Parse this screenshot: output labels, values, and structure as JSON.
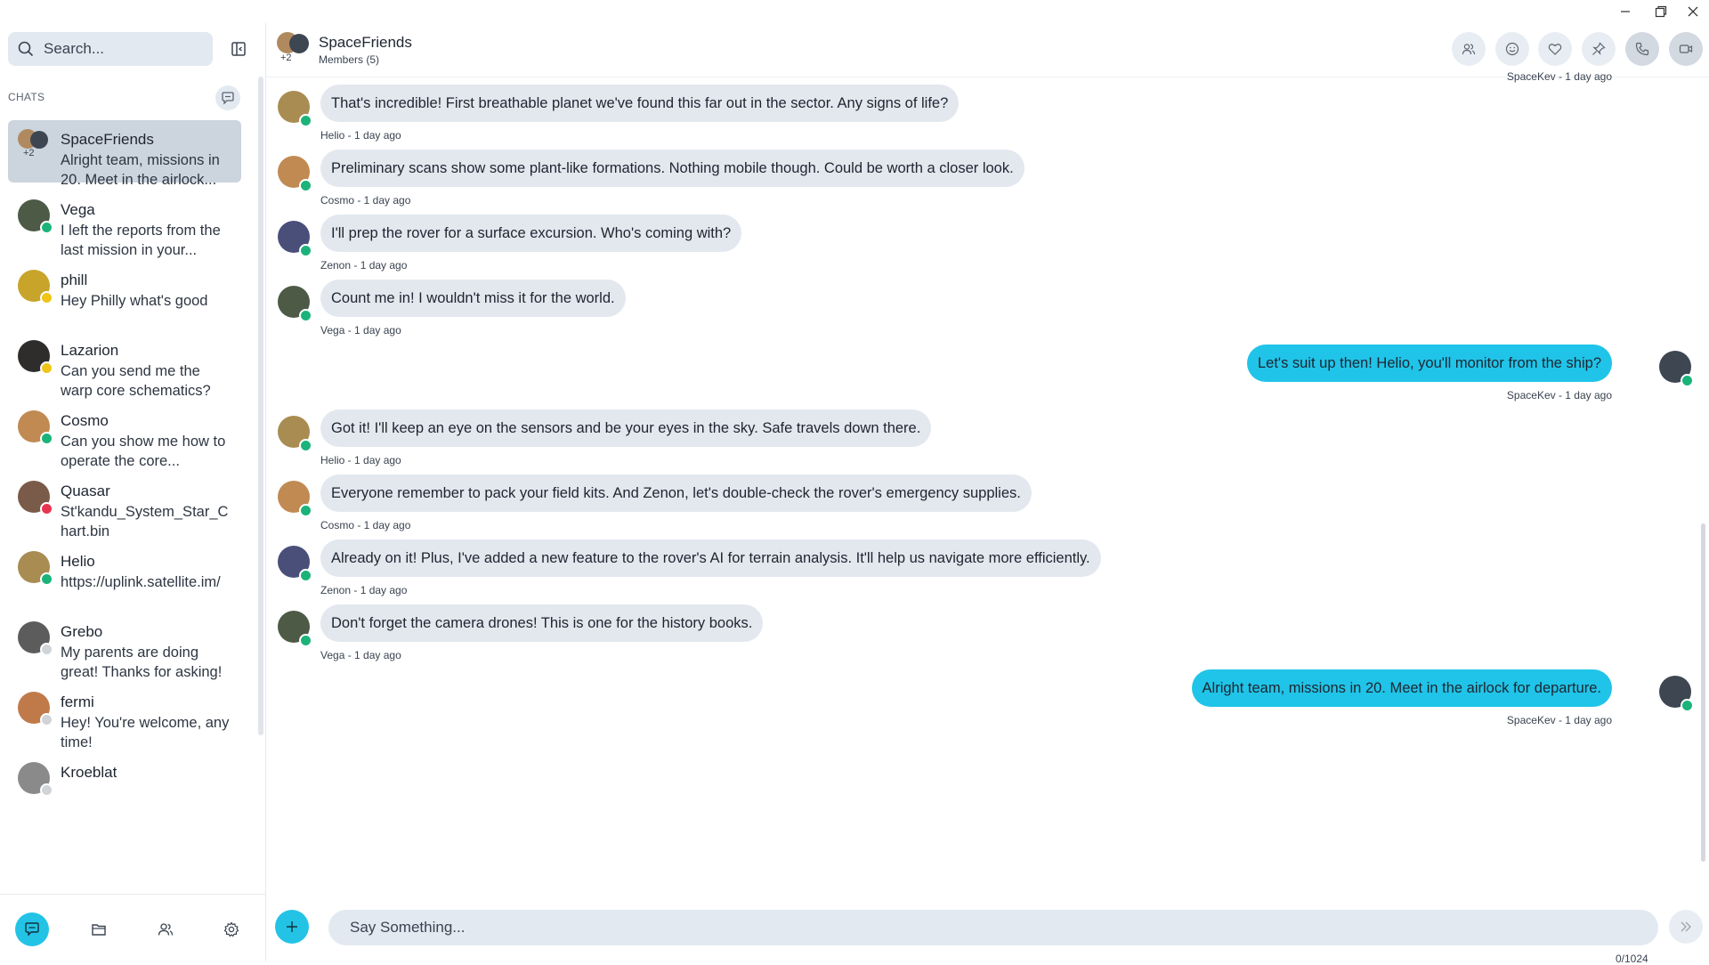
{
  "window": {
    "minimize": "—",
    "restore": "❐",
    "close": "✕"
  },
  "sidebar": {
    "search_placeholder": "Search...",
    "chats_label": "CHATS",
    "chats": [
      {
        "name": "SpaceFriends",
        "preview": "Alright team, missions in 20. Meet in the airlock...",
        "badge": "+2",
        "active": true,
        "status": "none",
        "avatar_color": "#8a7a66"
      },
      {
        "name": "Vega",
        "preview": "I left the reports from the last mission in your...",
        "status": "online",
        "avatar_color": "#4d5a46"
      },
      {
        "name": "phill",
        "preview": "Hey Philly what's good",
        "status": "away",
        "avatar_color": "#c8a42a"
      },
      {
        "name": "Lazarion",
        "preview": "Can you send me the warp core schematics?",
        "status": "away",
        "avatar_color": "#2f2d2c"
      },
      {
        "name": "Cosmo",
        "preview": "Can you show me how to operate the core...",
        "status": "online",
        "avatar_color": "#c08a52"
      },
      {
        "name": "Quasar",
        "preview": "St'kandu_System_Star_Chart.bin",
        "status": "busy",
        "avatar_color": "#7a5a48"
      },
      {
        "name": "Helio",
        "preview": "https://uplink.satellite.im/",
        "status": "online",
        "avatar_color": "#a88c52"
      },
      {
        "name": "Grebo",
        "preview": "My parents are doing great! Thanks for asking!",
        "status": "offline",
        "avatar_color": "#5c5c5c"
      },
      {
        "name": "fermi",
        "preview": "Hey! You're welcome, any time!",
        "status": "offline",
        "avatar_color": "#c07a4a"
      },
      {
        "name": "Kroeblat",
        "preview": "",
        "status": "offline",
        "avatar_color": "#8a8a8a"
      }
    ]
  },
  "header": {
    "title": "SpaceFriends",
    "subtitle": "Members (5)",
    "badge": "+2"
  },
  "messages": [
    {
      "author": "Helio",
      "text": "That's incredible! First breathable planet we've found this far out in the sector. Any signs of life?",
      "meta": "Helio - 1 day ago",
      "outgoing": false,
      "avatar_color": "#a88c52"
    },
    {
      "author": "Cosmo",
      "text": "Preliminary scans show some plant-like formations. Nothing mobile though. Could be worth a closer look.",
      "meta": "Cosmo - 1 day ago",
      "outgoing": false,
      "avatar_color": "#c08a52"
    },
    {
      "author": "Zenon",
      "text": "I'll prep the rover for a surface excursion. Who's coming with?",
      "meta": "Zenon - 1 day ago",
      "outgoing": false,
      "avatar_color": "#4a4f7a"
    },
    {
      "author": "Vega",
      "text": "Count me in! I wouldn't miss it for the world.",
      "meta": "Vega - 1 day ago",
      "outgoing": false,
      "avatar_color": "#4d5a46"
    },
    {
      "author": "SpaceKev",
      "text": "Let's suit up then! Helio, you'll monitor from the ship?",
      "meta": "SpaceKev - 1 day ago",
      "outgoing": true,
      "avatar_color": "#3e4652"
    },
    {
      "author": "Helio",
      "text": "Got it! I'll keep an eye on the sensors and be your eyes in the sky. Safe travels down there.",
      "meta": "Helio - 1 day ago",
      "outgoing": false,
      "avatar_color": "#a88c52"
    },
    {
      "author": "Cosmo",
      "text": "Everyone remember to pack your field kits. And Zenon, let's double-check the rover's emergency supplies.",
      "meta": "Cosmo - 1 day ago",
      "outgoing": false,
      "avatar_color": "#c08a52"
    },
    {
      "author": "Zenon",
      "text": "Already on it! Plus, I've added a new feature to the rover's AI for terrain analysis. It'll help us navigate more efficiently.",
      "meta": "Zenon - 1 day ago",
      "outgoing": false,
      "avatar_color": "#4a4f7a"
    },
    {
      "author": "Vega",
      "text": "Don't forget the camera drones! This is one for the history books.",
      "meta": "Vega - 1 day ago",
      "outgoing": false,
      "avatar_color": "#4d5a46"
    },
    {
      "author": "SpaceKev",
      "text": "Alright team, missions in 20. Meet in the airlock for departure.",
      "meta": "SpaceKev - 1 day ago",
      "outgoing": true,
      "avatar_color": "#3e4652"
    }
  ],
  "top_partial_meta": "SpaceKev - 1 day ago",
  "composer": {
    "placeholder": "Say Something...",
    "counter": "0/1024"
  },
  "colors": {
    "accent": "#23c3e6",
    "online": "#1bb37a",
    "away": "#f0c419",
    "busy": "#e8344e",
    "offline": "#d0d4d9"
  }
}
